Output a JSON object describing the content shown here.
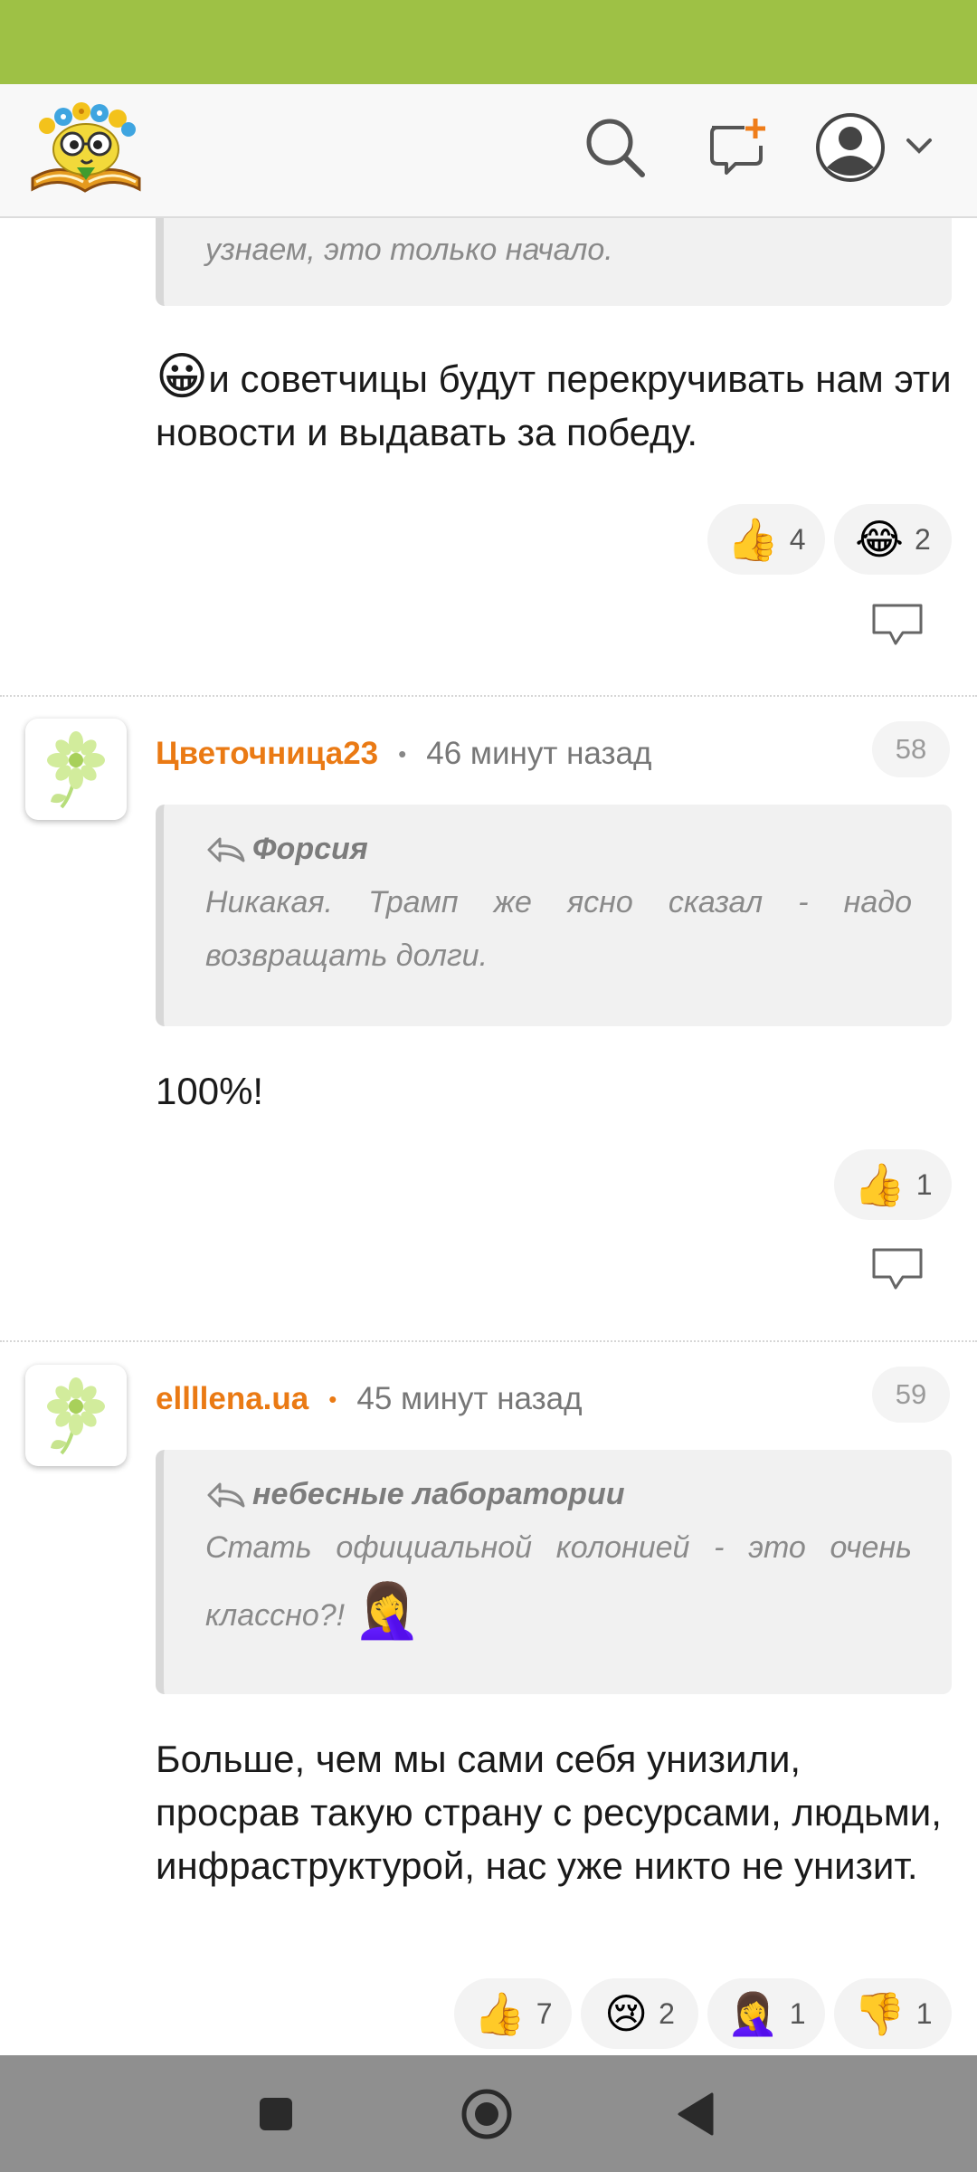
{
  "comments": [
    {
      "quote": {
        "text_end": "узнаем, это только начало."
      },
      "body_emoji": "😀",
      "body": "и советчицы будут перекручивать нам эти новости и выдавать за победу.",
      "reactions": [
        {
          "emoji": "👍",
          "count": "4"
        },
        {
          "emoji": "😂",
          "count": "2"
        }
      ]
    },
    {
      "username": "Цветочница23",
      "separator": "•",
      "time": "46 минут назад",
      "number": "58",
      "quote": {
        "author": "Форсия",
        "line1": "Никакая. Трамп же ясно сказал - надо",
        "line2": "возвращать долги."
      },
      "body": "100%!",
      "reactions": [
        {
          "emoji": "👍",
          "count": "1"
        }
      ]
    },
    {
      "username": "ellllena.ua",
      "separator": "•",
      "time": "45 минут назад",
      "number": "59",
      "quote": {
        "author": "небесные лаборатории",
        "line1": "Стать официальной колонией - это очень",
        "line2": "классно?!",
        "emoji": "🤦‍♀️"
      },
      "body": "Больше, чем мы сами себя унизили, просрав такую страну с ресурсами, людьми, инфраструктурой, нас уже никто не унизит.",
      "reactions": [
        {
          "emoji": "👍",
          "count": "7"
        },
        {
          "emoji": "😢",
          "count": "2"
        },
        {
          "emoji": "🤦‍♀️",
          "count": "1"
        },
        {
          "emoji": "👎",
          "count": "1"
        }
      ]
    }
  ],
  "colors": {
    "statusbar": "#9ec145",
    "username": "#ea7a14",
    "navbar": "#8f8f8f"
  },
  "icons": [
    "site-logo-icon",
    "search-icon",
    "new-post-icon",
    "user-avatar-icon",
    "chevron-down-icon",
    "reply-icon",
    "quote-arrow-icon",
    "flower-avatar-icon",
    "nav-square-icon",
    "nav-home-icon",
    "nav-back-icon"
  ]
}
